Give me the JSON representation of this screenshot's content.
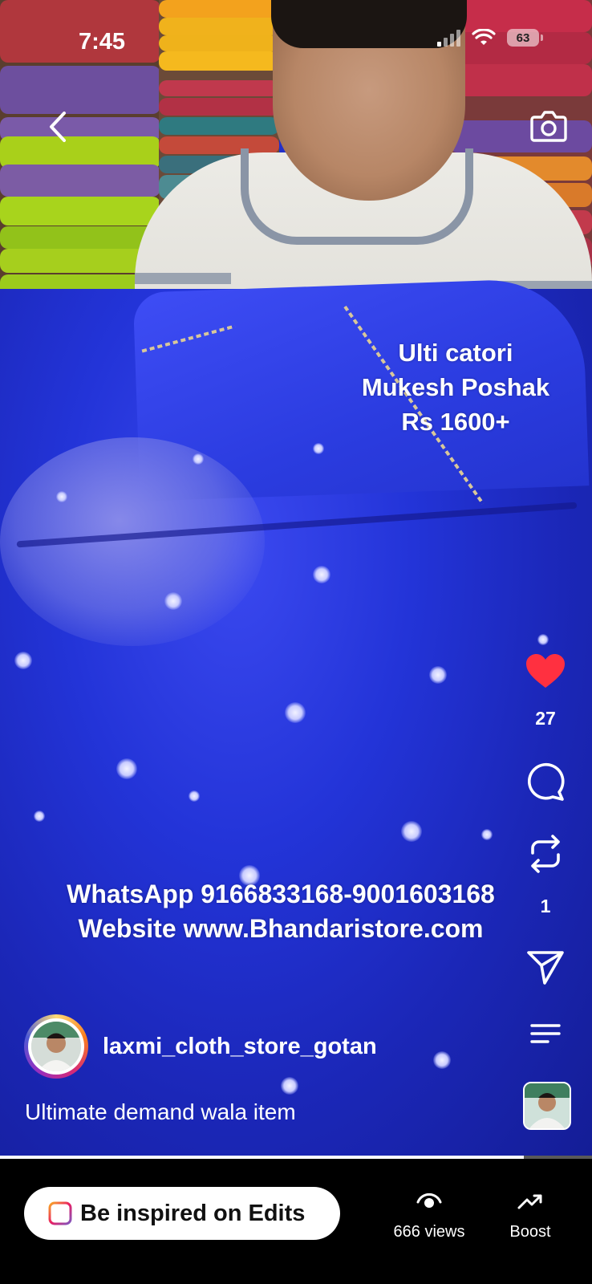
{
  "status_bar": {
    "time": "7:45",
    "battery": "63"
  },
  "overlay": {
    "product_lines": [
      "Ulti catori",
      "Mukesh Poshak",
      "Rs 1600+"
    ],
    "contact_lines": [
      "WhatsApp 9166833168-9001603168",
      "Website www.Bhandaristore.com"
    ]
  },
  "actions": {
    "likes": "27",
    "reposts": "1"
  },
  "author": {
    "username": "laxmi_cloth_store_gotan"
  },
  "caption": "Ultimate demand wala item",
  "progress": 0.885,
  "bottom_bar": {
    "edits_label": "Be inspired on Edits",
    "views": "666 views",
    "boost": "Boost"
  },
  "icons": [
    "back-icon",
    "camera-icon",
    "heart-icon",
    "comment-icon",
    "repost-icon",
    "share-icon",
    "more-icon",
    "edits-icon",
    "views-icon",
    "boost-icon"
  ],
  "colors": {
    "like": "#ff3040",
    "fabric_blue": "#2334d8",
    "bar_bg": "#000000"
  }
}
